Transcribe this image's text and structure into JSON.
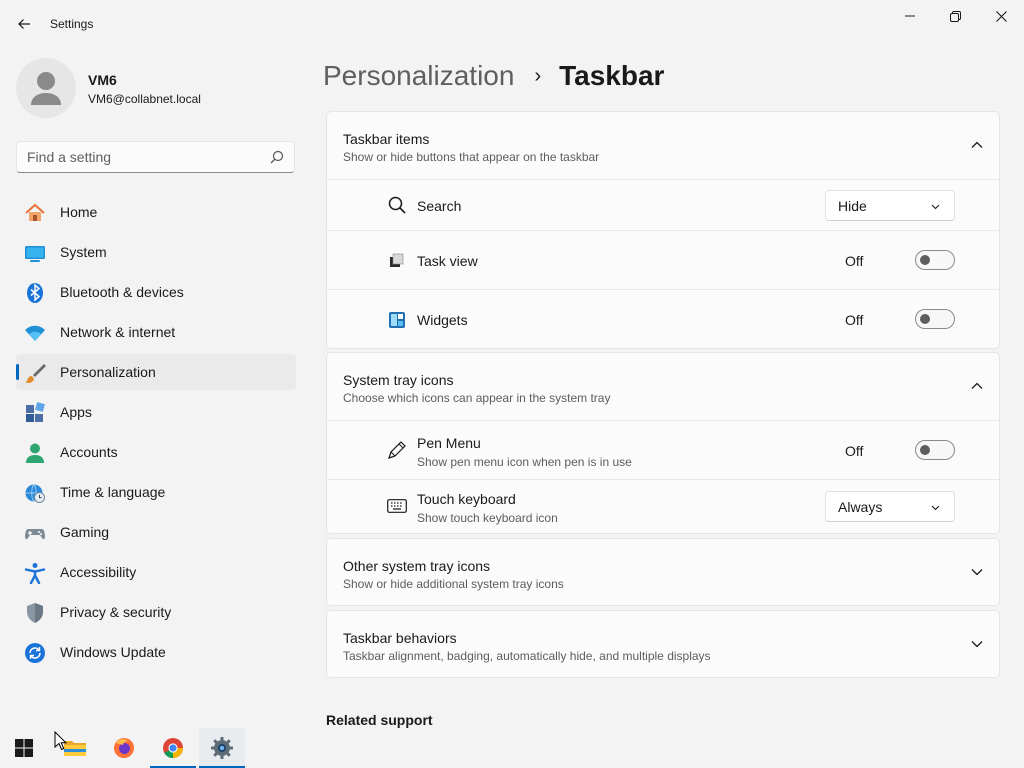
{
  "window": {
    "title": "Settings",
    "controls": {
      "minimize": "minimize-icon",
      "maximize": "maximize-icon",
      "close": "close-icon"
    }
  },
  "profile": {
    "name": "VM6",
    "email": "VM6@collabnet.local"
  },
  "search": {
    "placeholder": "Find a setting",
    "value": ""
  },
  "nav": {
    "items": [
      {
        "label": "Home",
        "icon": "home-icon"
      },
      {
        "label": "System",
        "icon": "monitor-icon"
      },
      {
        "label": "Bluetooth & devices",
        "icon": "bluetooth-icon"
      },
      {
        "label": "Network & internet",
        "icon": "wifi-icon"
      },
      {
        "label": "Personalization",
        "icon": "brush-icon",
        "selected": true
      },
      {
        "label": "Apps",
        "icon": "apps-icon"
      },
      {
        "label": "Accounts",
        "icon": "person-icon"
      },
      {
        "label": "Time & language",
        "icon": "globe-clock-icon"
      },
      {
        "label": "Gaming",
        "icon": "controller-icon"
      },
      {
        "label": "Accessibility",
        "icon": "accessibility-icon"
      },
      {
        "label": "Privacy & security",
        "icon": "shield-icon"
      },
      {
        "label": "Windows Update",
        "icon": "update-icon"
      }
    ]
  },
  "header": {
    "parent": "Personalization",
    "separator": "›",
    "current": "Taskbar"
  },
  "sections": {
    "taskbar_items": {
      "title": "Taskbar items",
      "subtitle": "Show or hide buttons that appear on the taskbar",
      "expanded": true,
      "rows": {
        "search": {
          "label": "Search",
          "value": "Hide",
          "icon": "search-icon"
        },
        "task_view": {
          "label": "Task view",
          "state": "Off",
          "icon": "task-view-icon"
        },
        "widgets": {
          "label": "Widgets",
          "state": "Off",
          "icon": "widgets-icon"
        }
      }
    },
    "system_tray": {
      "title": "System tray icons",
      "subtitle": "Choose which icons can appear in the system tray",
      "expanded": true,
      "rows": {
        "pen_menu": {
          "label": "Pen Menu",
          "sub": "Show pen menu icon when pen is in use",
          "state": "Off",
          "icon": "pen-icon"
        },
        "touch_keyboard": {
          "label": "Touch keyboard",
          "sub": "Show touch keyboard icon",
          "value": "Always",
          "icon": "keyboard-icon"
        }
      }
    },
    "other_tray": {
      "title": "Other system tray icons",
      "subtitle": "Show or hide additional system tray icons",
      "expanded": false
    },
    "behaviors": {
      "title": "Taskbar behaviors",
      "subtitle": "Taskbar alignment, badging, automatically hide, and multiple displays",
      "expanded": false
    }
  },
  "related": {
    "title": "Related support"
  },
  "taskbar": {
    "items": [
      "start-icon",
      "file-explorer-icon",
      "firefox-icon",
      "chrome-icon",
      "settings-icon"
    ]
  },
  "colors": {
    "accent": "#0067c0",
    "background": "#f3f3f3",
    "card": "#fbfbfb"
  }
}
